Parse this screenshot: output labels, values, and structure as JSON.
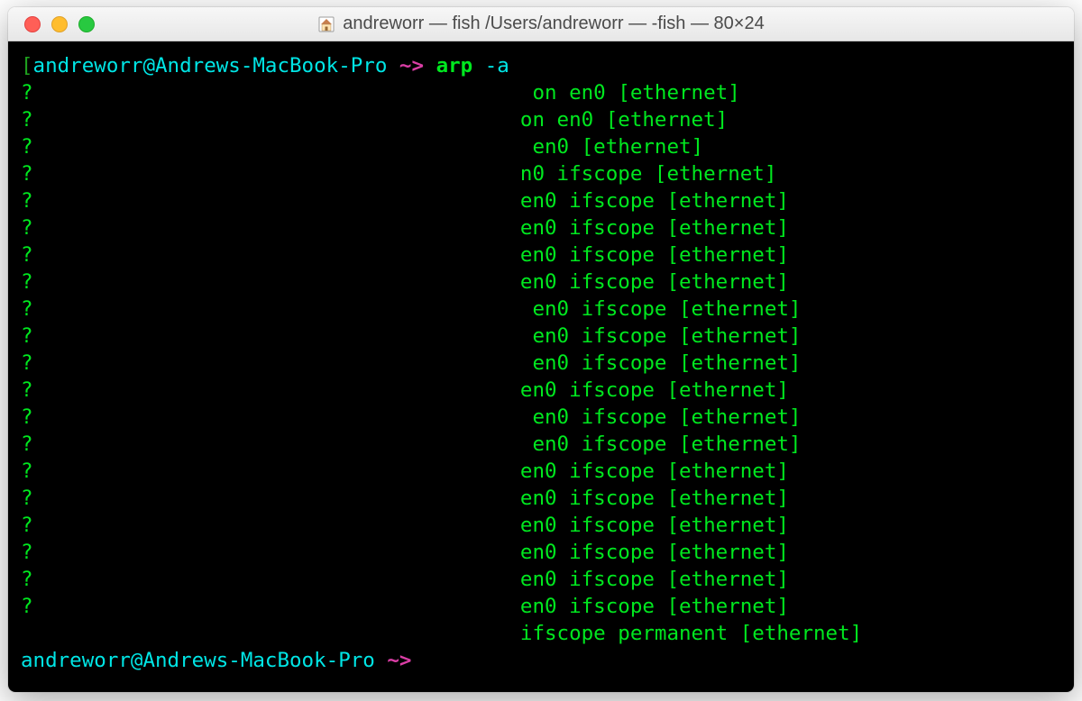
{
  "titlebar": {
    "title": "andreworr — fish  /Users/andreworr — -fish — 80×24"
  },
  "prompt": {
    "open": "[",
    "userhost": "andreworr@Andrews-MacBook-Pro",
    "tilde_arrow": " ~> ",
    "cmd": "arp",
    "space": " ",
    "flag": "-a",
    "close_bracket": "]"
  },
  "output": [
    {
      "left": "?",
      "right": " on en0 [ethernet]"
    },
    {
      "left": "?",
      "right": "on en0 [ethernet]"
    },
    {
      "left": "?",
      "right": " en0 [ethernet]"
    },
    {
      "left": "?",
      "right": "n0 ifscope [ethernet]"
    },
    {
      "left": "?",
      "right": "en0 ifscope [ethernet]"
    },
    {
      "left": "?",
      "right": "en0 ifscope [ethernet]"
    },
    {
      "left": "?",
      "right": "en0 ifscope [ethernet]"
    },
    {
      "left": "?",
      "right": "en0 ifscope [ethernet]"
    },
    {
      "left": "?",
      "right": " en0 ifscope [ethernet]"
    },
    {
      "left": "?",
      "right": " en0 ifscope [ethernet]"
    },
    {
      "left": "?",
      "right": " en0 ifscope [ethernet]"
    },
    {
      "left": "?",
      "right": "en0 ifscope [ethernet]"
    },
    {
      "left": "?",
      "right": " en0 ifscope [ethernet]"
    },
    {
      "left": "?",
      "right": " en0 ifscope [ethernet]"
    },
    {
      "left": "?",
      "right": "en0 ifscope [ethernet]"
    },
    {
      "left": "?",
      "right": "en0 ifscope [ethernet]"
    },
    {
      "left": "?",
      "right": "en0 ifscope [ethernet]"
    },
    {
      "left": "?",
      "right": "en0 ifscope [ethernet]"
    },
    {
      "left": "?",
      "right": "en0 ifscope [ethernet]"
    },
    {
      "left": "?",
      "right": "en0 ifscope [ethernet]"
    },
    {
      "left": "",
      "right": "ifscope permanent [ethernet]"
    }
  ],
  "prompt2": {
    "userhost": "andreworr@Andrews-MacBook-Pro",
    "tilde_arrow": " ~> "
  }
}
